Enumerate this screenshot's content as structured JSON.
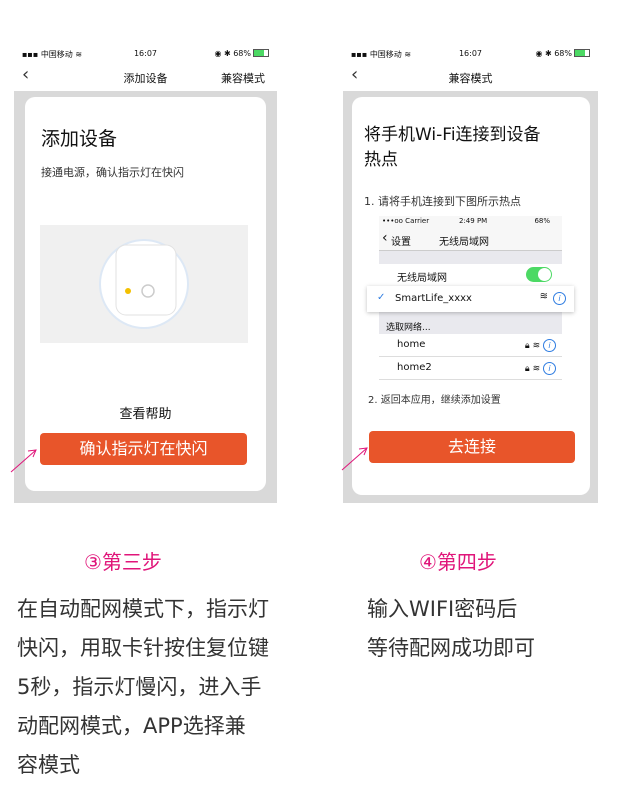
{
  "screen3": {
    "status": {
      "carrier": "中国移动",
      "time": "16:07",
      "battery": "68%"
    },
    "nav": {
      "title": "添加设备",
      "right": "兼容模式"
    },
    "heading": "添加设备",
    "subtitle": "接通电源，确认指示灯在快闪",
    "help": "查看帮助",
    "button": "确认指示灯在快闪"
  },
  "screen4": {
    "status": {
      "carrier": "中国移动",
      "time": "16:07",
      "battery": "68%"
    },
    "nav": {
      "title": "兼容模式"
    },
    "heading_line1": "将手机Wi-Fi连接到设备",
    "heading_line2": "热点",
    "step1": "1. 请将手机连接到下图所示热点",
    "ios": {
      "status": {
        "carrier": "•••oo Carrier",
        "time": "2:49 PM",
        "battery": "68%"
      },
      "back": "设置",
      "title": "无线局域网",
      "wlan_label": "无线局域网",
      "selected": "SmartLife_xxxx",
      "section": "选取网络...",
      "networks": [
        "home",
        "home2"
      ]
    },
    "step2": "2. 返回本应用，继续添加设置",
    "button": "去连接"
  },
  "captions": {
    "step3_title": "③第三步",
    "step3_lines": [
      "在自动配网模式下，指示灯",
      "快闪，用取卡针按住复位键",
      "5秒，指示灯慢闪，进入手",
      "动配网模式，APP选择兼",
      "容模式"
    ],
    "step4_title": "④第四步",
    "step4_lines": [
      "输入WIFI密码后",
      "等待配网成功即可"
    ]
  },
  "colors": {
    "accent": "#e8552a",
    "step_title": "#e0157a",
    "toggle": "#4cd964",
    "info": "#2f7de1"
  }
}
